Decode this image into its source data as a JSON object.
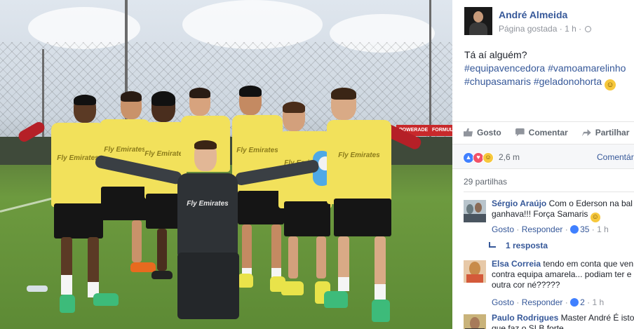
{
  "post": {
    "author": "André Almeida",
    "meta_page": "Página gostada",
    "meta_sep": " · ",
    "meta_time": "1 h",
    "meta_sep2": " · ",
    "message_line1": "Tá aí alguém?",
    "hashtags": [
      "#equipavencedora",
      "#vamoamarelinho",
      "#chupasamaris",
      "#geladonohorta"
    ]
  },
  "photo": {
    "bib_sponsor": "Fly Emirates",
    "gk_sponsor": "Fly Emirates",
    "adboard_text": "POWERADE",
    "adboard_text2": "FORMUL"
  },
  "actions": {
    "like_label": "Gosto",
    "comment_label": "Comentar",
    "share_label": "Partilhar"
  },
  "reactions": {
    "count": "2,6 m",
    "comments_link": "Comentár"
  },
  "shares": "29 partilhas",
  "comments": [
    {
      "name": "Sérgio Araújo",
      "text": " Com o Ederson na bal ganhava!!! Força Samaris ",
      "like": "Gosto",
      "reply": "Responder",
      "likes": "35",
      "time": "1 h"
    },
    {
      "name": "Elsa Correia",
      "text": " tendo em conta que ven contra equipa amarela... podiam ter e outra cor né?????",
      "like": "Gosto",
      "reply": "Responder",
      "likes": "2",
      "time": "1 h"
    },
    {
      "name": "Paulo Rodrigues",
      "text": " Master André É isto que faz o SLB forte"
    }
  ],
  "replies_link": "1 resposta",
  "colors": {
    "link": "#365899",
    "muted": "#90949c",
    "bib": "#f2e15b",
    "like_blue": "#4080ff",
    "love_red": "#f25268"
  }
}
